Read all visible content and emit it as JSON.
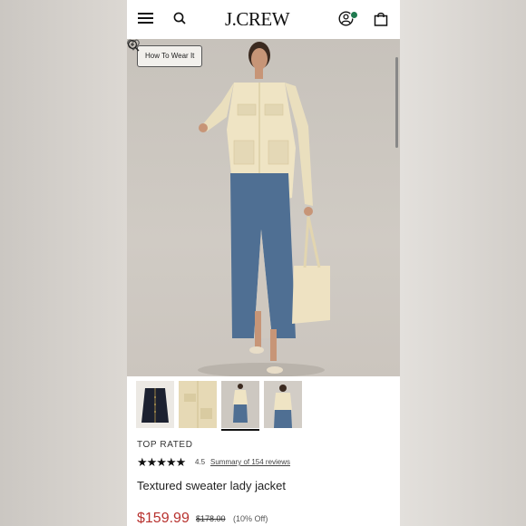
{
  "header": {
    "logo": "J.CREW"
  },
  "hero": {
    "how_to_label": "How To Wear It"
  },
  "thumbnails": [
    {
      "name": "navy jacket"
    },
    {
      "name": "jacket detail"
    },
    {
      "name": "full look"
    },
    {
      "name": "back view"
    }
  ],
  "product": {
    "badge": "TOP RATED",
    "stars": "★★★★★",
    "rating": "4.5",
    "reviews_link": "Summary of 154 reviews",
    "title": "Textured sweater lady jacket",
    "price": "$159.99",
    "original_price": "$178.00",
    "discount": "(10% Off)"
  },
  "colors": {
    "price_red": "#b8322f",
    "account_badge_green": "#1f7a4f"
  }
}
